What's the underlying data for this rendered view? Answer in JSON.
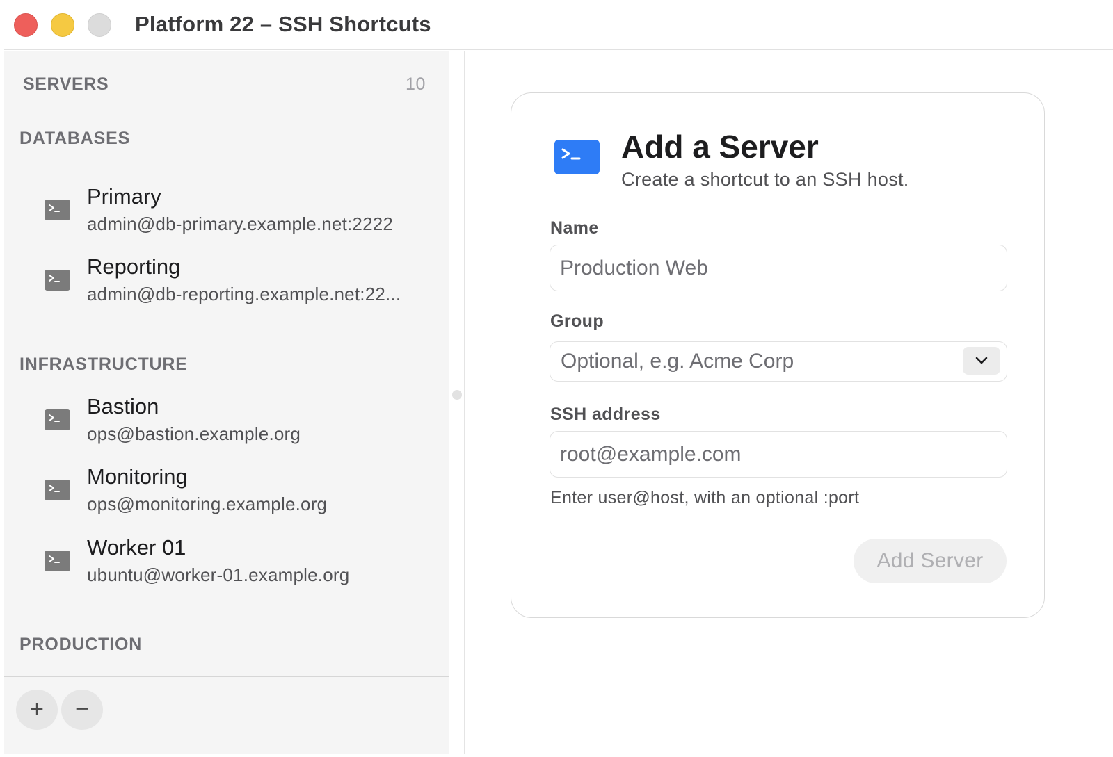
{
  "window": {
    "title": "Platform 22 – SSH Shortcuts"
  },
  "sidebar": {
    "header": "SERVERS",
    "count": "10",
    "groups": [
      {
        "label": "DATABASES",
        "items": [
          {
            "name": "Primary",
            "address": "admin@db-primary.example.net:2222"
          },
          {
            "name": "Reporting",
            "address": "admin@db-reporting.example.net:22..."
          }
        ]
      },
      {
        "label": "INFRASTRUCTURE",
        "items": [
          {
            "name": "Bastion",
            "address": "ops@bastion.example.org"
          },
          {
            "name": "Monitoring",
            "address": "ops@monitoring.example.org"
          },
          {
            "name": "Worker 01",
            "address": "ubuntu@worker-01.example.org"
          }
        ]
      },
      {
        "label": "PRODUCTION",
        "items": []
      }
    ],
    "footer": {
      "add_label": "+",
      "remove_label": "−"
    }
  },
  "form": {
    "title": "Add a Server",
    "subtitle": "Create a shortcut to an SSH host.",
    "name_label": "Name",
    "name_placeholder": "Production Web",
    "group_label": "Group",
    "group_placeholder": "Optional, e.g. Acme Corp",
    "address_label": "SSH address",
    "address_placeholder": "root@example.com",
    "address_help": "Enter user@host, with an optional :port",
    "submit_label": "Add Server"
  },
  "icons": {
    "server": "terminal-icon",
    "form_header": "terminal-icon",
    "select": "chevron-down-icon"
  },
  "colors": {
    "accent": "#2e7cf6",
    "sidebar_bg": "#f5f5f5",
    "close": "#ee5f5b",
    "minimize": "#f5c942",
    "zoom_inactive": "#dcdcdc"
  }
}
